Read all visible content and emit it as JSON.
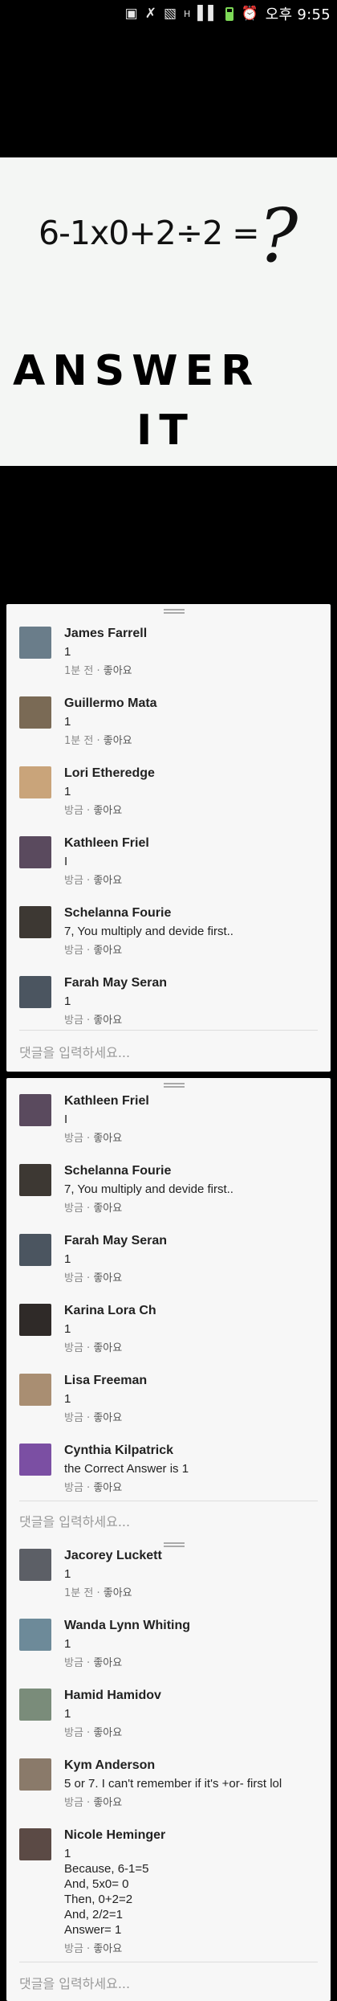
{
  "status_bar": {
    "icons": [
      "image-icon",
      "mute-icon",
      "vibrate-icon",
      "network-icon",
      "signal-icon",
      "battery-icon",
      "alarm-icon"
    ],
    "network_label": "H",
    "time": "오후 9:55"
  },
  "meme": {
    "equation": "6-1x0+2÷2 =",
    "question_mark": "?",
    "line1": "ANSWER",
    "line2": "IT"
  },
  "like_label": "좋아요",
  "input_placeholder": "댓글을 입력하세요...",
  "panels": [
    {
      "comments": [
        {
          "name": "James Farrell",
          "text": "1",
          "time": "1분 전",
          "avatar_color": "#6a7d8a"
        },
        {
          "name": "Guillermo Mata",
          "text": "1",
          "time": "1분 전",
          "avatar_color": "#7a6a55"
        },
        {
          "name": "Lori Etheredge",
          "text": "1",
          "time": "방금",
          "avatar_color": "#c9a47a"
        },
        {
          "name": "Kathleen Friel",
          "text": "I",
          "time": "방금",
          "avatar_color": "#5a4a5e"
        },
        {
          "name": "Schelanna Fourie",
          "text": "7, You multiply and devide first..",
          "time": "방금",
          "avatar_color": "#3d3833"
        },
        {
          "name": "Farah May Seran",
          "text": "1",
          "time": "방금",
          "avatar_color": "#4b5560"
        }
      ]
    },
    {
      "comments": [
        {
          "name": "Kathleen Friel",
          "text": "I",
          "time": "방금",
          "avatar_color": "#5a4a5e"
        },
        {
          "name": "Schelanna Fourie",
          "text": "7, You multiply and devide first..",
          "time": "방금",
          "avatar_color": "#3d3833"
        },
        {
          "name": "Farah May Seran",
          "text": "1",
          "time": "방금",
          "avatar_color": "#4b5560"
        },
        {
          "name": "Karina Lora Ch",
          "text": "1",
          "time": "방금",
          "avatar_color": "#2f2a28"
        },
        {
          "name": "Lisa Freeman",
          "text": "1",
          "time": "방금",
          "avatar_color": "#a98e72"
        },
        {
          "name": "Cynthia Kilpatrick",
          "text": "the Correct Answer is 1",
          "time": "방금",
          "avatar_color": "#7b4fa3"
        }
      ]
    },
    {
      "comments": [
        {
          "name": "Jacorey Luckett",
          "text": "1",
          "time": "1분 전",
          "avatar_color": "#5c5f66"
        },
        {
          "name": "Wanda Lynn Whiting",
          "text": "1",
          "time": "방금",
          "avatar_color": "#6d8a99"
        },
        {
          "name": "Hamid Hamidov",
          "text": "1",
          "time": "방금",
          "avatar_color": "#7a8c7a"
        },
        {
          "name": "Kym Anderson",
          "text": "5 or 7. I can't remember if it's +or- first lol",
          "time": "방금",
          "avatar_color": "#8a7a6a"
        },
        {
          "name": "Nicole Heminger",
          "text": "1\nBecause, 6-1=5\nAnd, 5x0= 0\nThen, 0+2=2\nAnd, 2/2=1\nAnswer= 1",
          "time": "방금",
          "avatar_color": "#5b4a45"
        }
      ]
    }
  ]
}
